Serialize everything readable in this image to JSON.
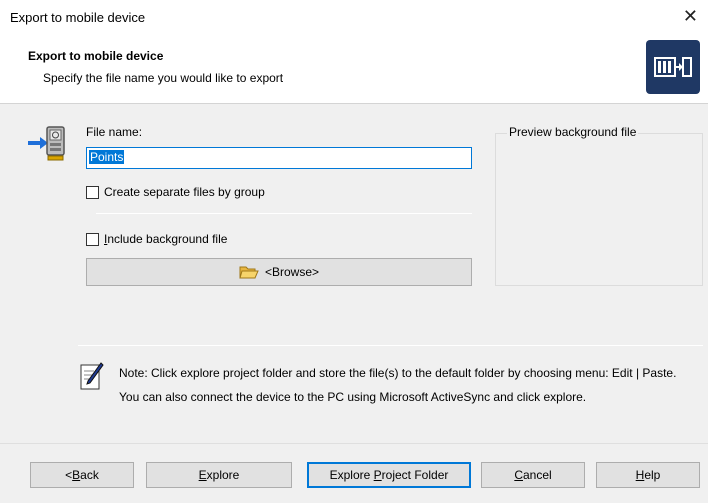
{
  "window": {
    "title": "Export to mobile device"
  },
  "header": {
    "title": "Export to mobile device",
    "subtitle": "Specify the file name you would like to export"
  },
  "form": {
    "file_name_label": "File name:",
    "file_name_value": "Points",
    "separate_files_label": "Create separate files by group",
    "separate_files_checked": false,
    "include_bg_label_first": "I",
    "include_bg_label_rest": "nclude background file",
    "include_bg_checked": false,
    "browse_label": "<Browse>"
  },
  "preview": {
    "title": "Preview background file"
  },
  "note": {
    "text": "Note: Click explore project folder and store the file(s) to the default folder by choosing menu: Edit | Paste. You can also connect the device to the PC using Microsoft ActiveSync and click explore."
  },
  "buttons": {
    "back": {
      "pre": "< ",
      "u": "B",
      "post": "ack"
    },
    "explore": {
      "pre": "",
      "u": "E",
      "post": "xplore"
    },
    "explore_project": {
      "pre": "Explore ",
      "u": "P",
      "post": "roject Folder"
    },
    "cancel": {
      "pre": "",
      "u": "C",
      "post": "ancel"
    },
    "help": {
      "pre": "",
      "u": "H",
      "post": "elp"
    }
  },
  "colors": {
    "accent": "#0078d7",
    "logo_bg": "#1f3864"
  }
}
